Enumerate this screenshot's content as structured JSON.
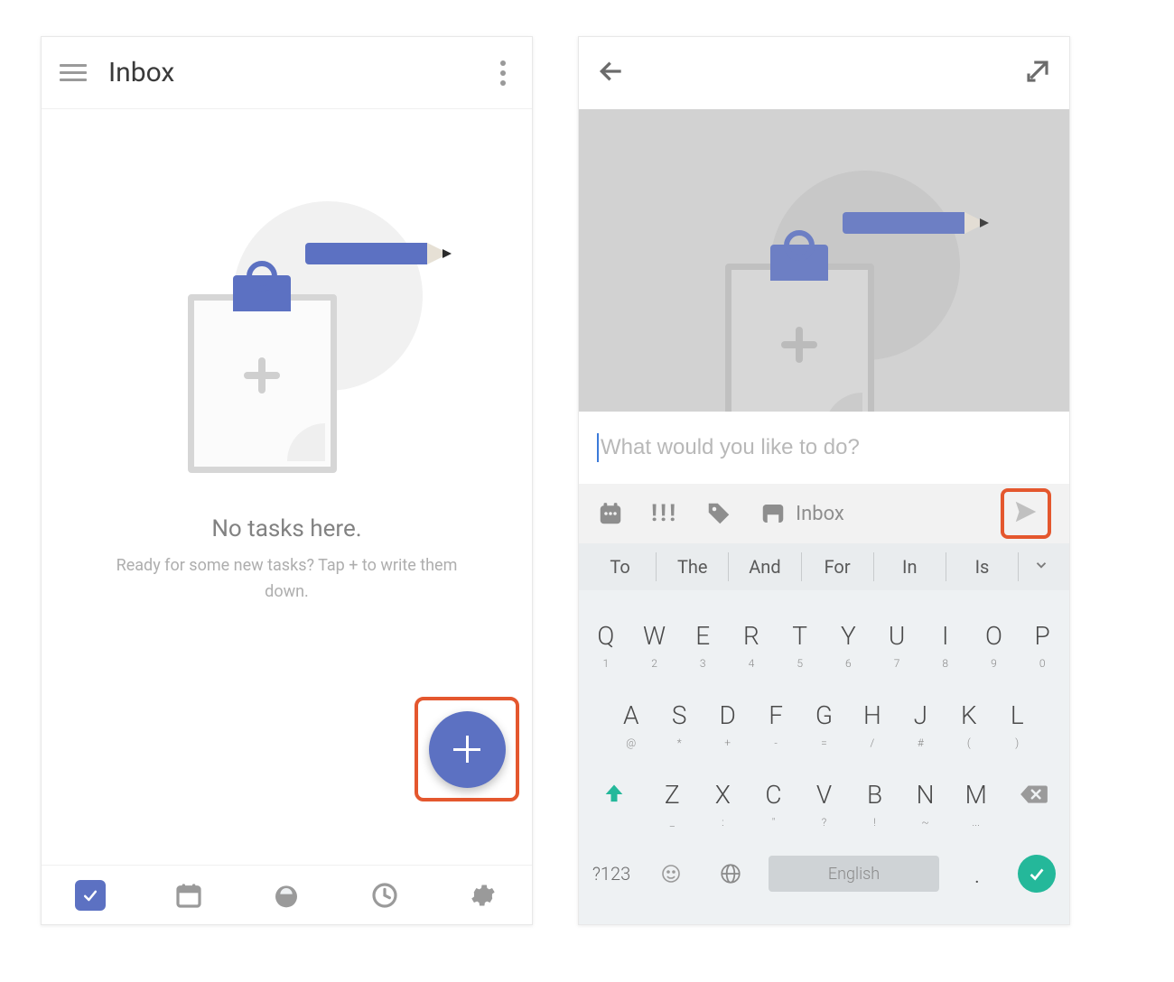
{
  "left": {
    "title": "Inbox",
    "emptyTitle": "No tasks here.",
    "emptySub": "Ready for some new tasks? Tap + to write them down."
  },
  "right": {
    "placeholder": "What would you like to do?",
    "optionLabel": "Inbox",
    "spaceLabel": "English",
    "suggestions": [
      "To",
      "The",
      "And",
      "For",
      "In",
      "Is"
    ],
    "rows": {
      "r1": [
        {
          "k": "Q",
          "s": "1"
        },
        {
          "k": "W",
          "s": "2"
        },
        {
          "k": "E",
          "s": "3"
        },
        {
          "k": "R",
          "s": "4"
        },
        {
          "k": "T",
          "s": "5"
        },
        {
          "k": "Y",
          "s": "6"
        },
        {
          "k": "U",
          "s": "7"
        },
        {
          "k": "I",
          "s": "8"
        },
        {
          "k": "O",
          "s": "9"
        },
        {
          "k": "P",
          "s": "0"
        }
      ],
      "r2": [
        {
          "k": "A",
          "s": "@"
        },
        {
          "k": "S",
          "s": "*"
        },
        {
          "k": "D",
          "s": "+"
        },
        {
          "k": "F",
          "s": "-"
        },
        {
          "k": "G",
          "s": "="
        },
        {
          "k": "H",
          "s": "/"
        },
        {
          "k": "J",
          "s": "#"
        },
        {
          "k": "K",
          "s": "("
        },
        {
          "k": "L",
          "s": ")"
        }
      ],
      "r3": [
        {
          "k": "Z",
          "s": "_"
        },
        {
          "k": "X",
          "s": ":"
        },
        {
          "k": "C",
          "s": "\""
        },
        {
          "k": "V",
          "s": "?"
        },
        {
          "k": "B",
          "s": "!"
        },
        {
          "k": "N",
          "s": "~"
        },
        {
          "k": "M",
          "s": "..."
        }
      ]
    },
    "symKey": "?123",
    "dotKey": "."
  }
}
